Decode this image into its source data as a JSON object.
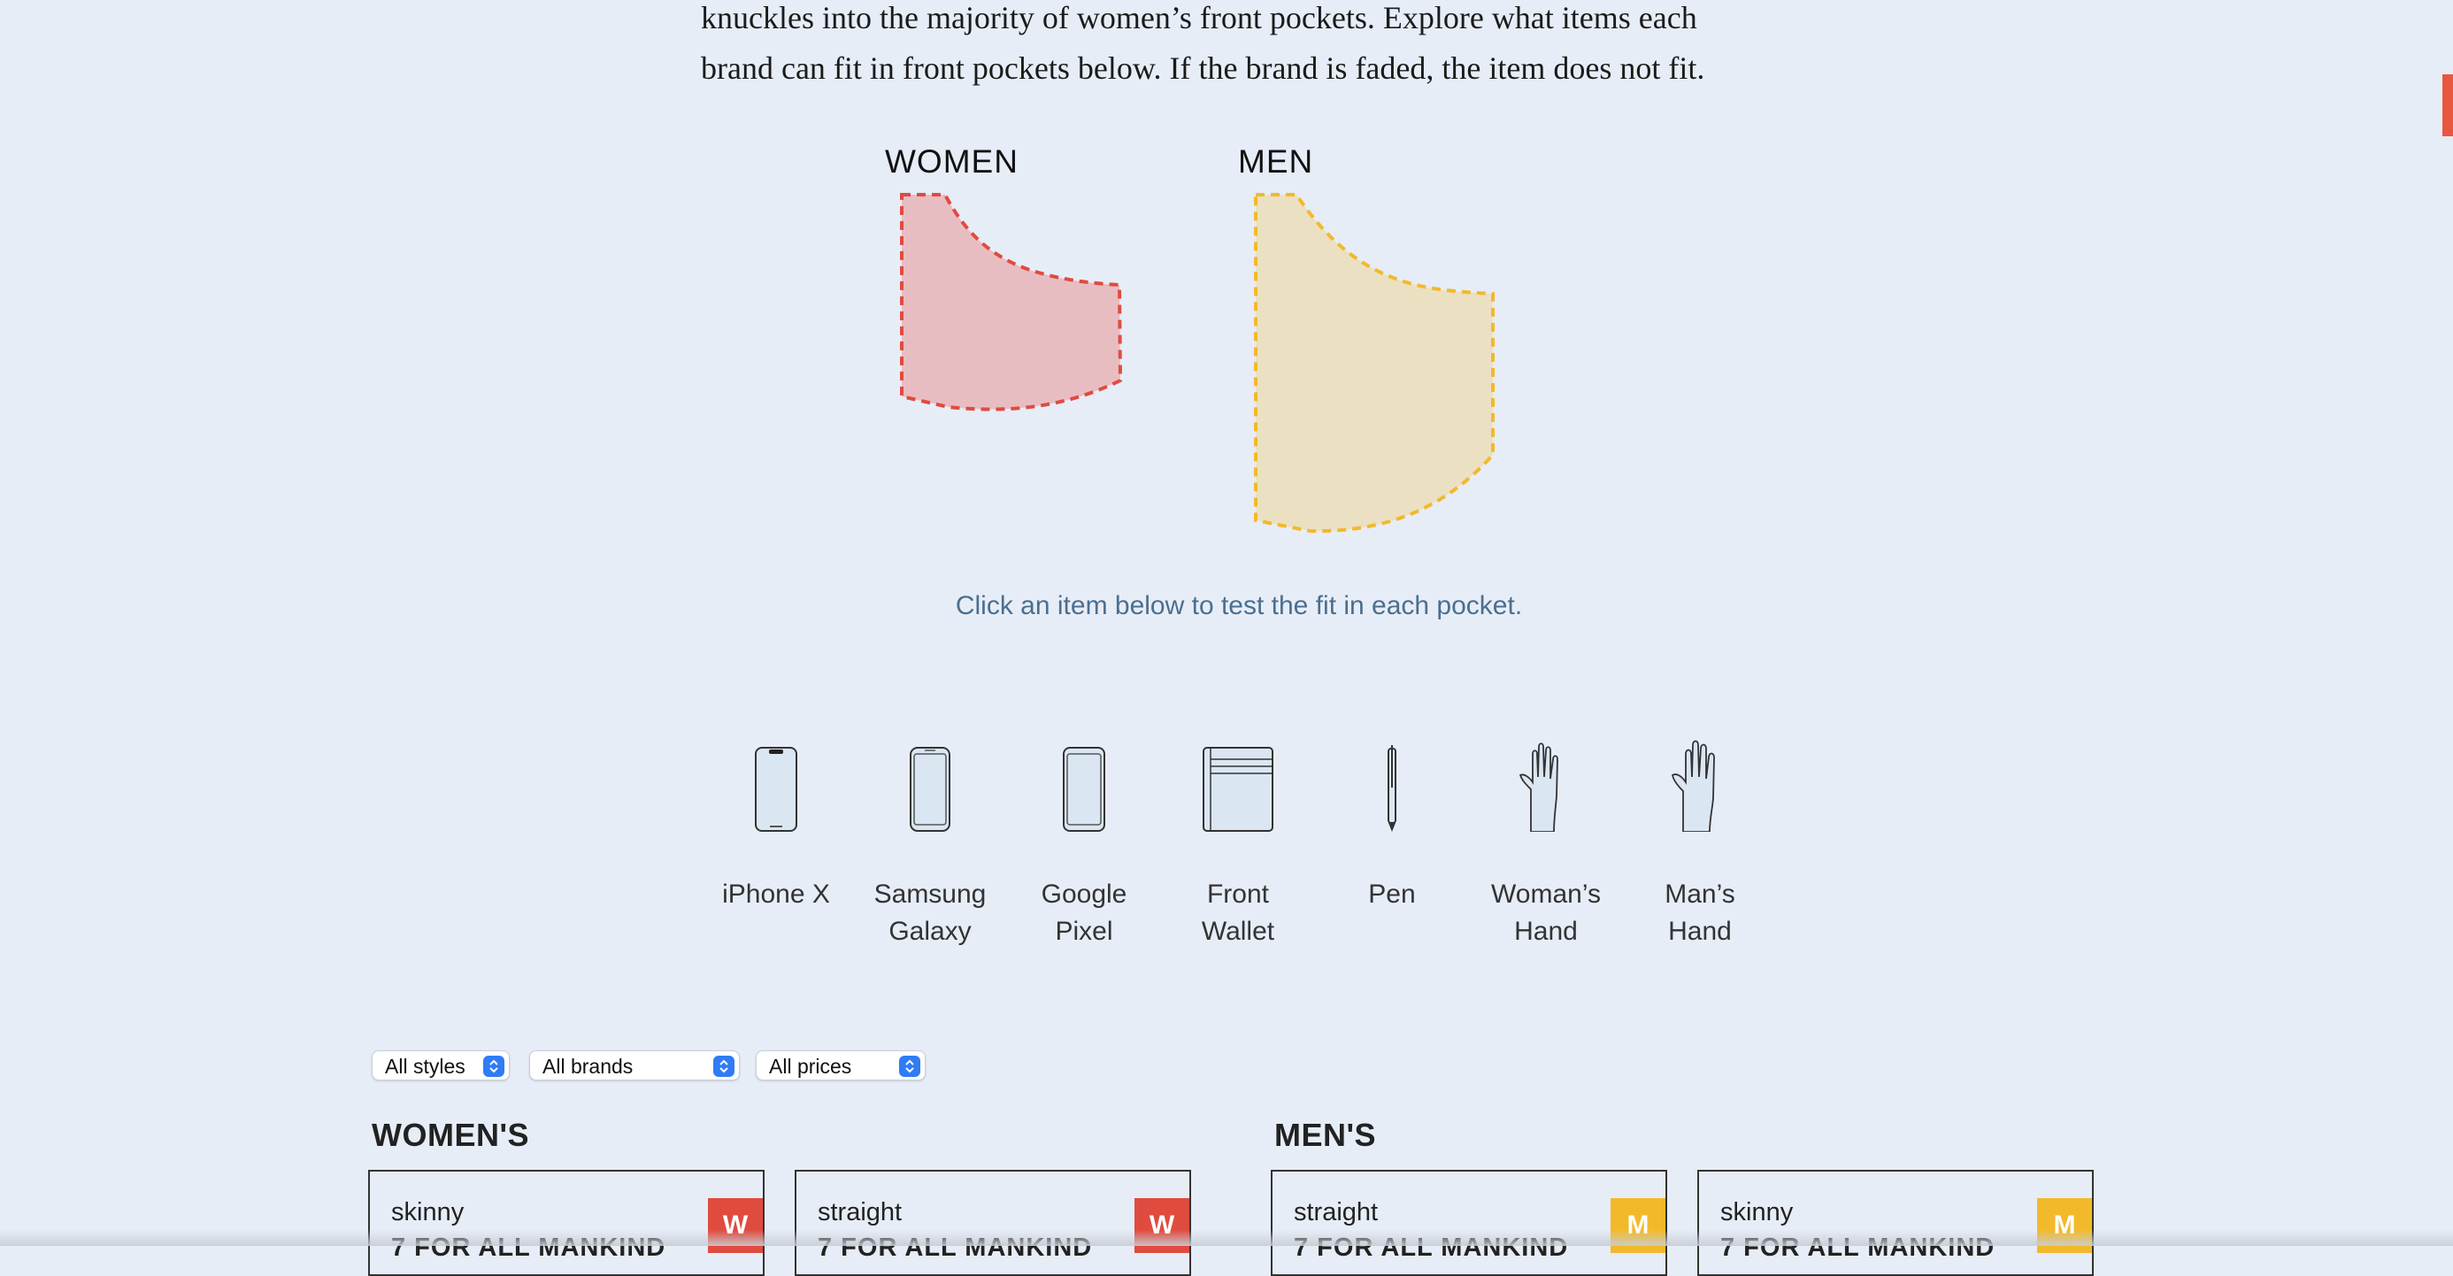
{
  "intro": {
    "line1": "knuckles into the majority of women’s front pockets. Explore what items each",
    "line2": "brand can fit in front pockets below. If the brand is faded, the item does not fit."
  },
  "pockets": {
    "women_label": "WOMEN",
    "men_label": "MEN",
    "women_color": "#e8bdc2",
    "women_stroke": "#e04b3f",
    "men_color": "#ece0c2",
    "men_stroke": "#f2b92a"
  },
  "hint": "Click an item below to test the fit in each pocket.",
  "items": [
    {
      "icon": "iphone-x-icon",
      "line1": "iPhone X",
      "line2": ""
    },
    {
      "icon": "samsung-galaxy-icon",
      "line1": "Samsung",
      "line2": "Galaxy"
    },
    {
      "icon": "google-pixel-icon",
      "line1": "Google",
      "line2": "Pixel"
    },
    {
      "icon": "front-wallet-icon",
      "line1": "Front",
      "line2": "Wallet"
    },
    {
      "icon": "pen-icon",
      "line1": "Pen",
      "line2": ""
    },
    {
      "icon": "womans-hand-icon",
      "line1": "Woman’s",
      "line2": "Hand"
    },
    {
      "icon": "mans-hand-icon",
      "line1": "Man’s",
      "line2": "Hand"
    }
  ],
  "filters": {
    "styles": "All styles",
    "brands": "All brands",
    "prices": "All prices"
  },
  "sections": {
    "womens": "WOMEN'S",
    "mens": "MEN'S"
  },
  "cards": [
    {
      "style": "skinny",
      "brand": "7 FOR ALL MANKIND",
      "badge": "W",
      "badge_color": "#e04b3f"
    },
    {
      "style": "straight",
      "brand": "7 FOR ALL MANKIND",
      "badge": "W",
      "badge_color": "#e04b3f"
    },
    {
      "style": "straight",
      "brand": "7 FOR ALL MANKIND",
      "badge": "M",
      "badge_color": "#f2b92a"
    },
    {
      "style": "skinny",
      "brand": "7 FOR ALL MANKIND",
      "badge": "M",
      "badge_color": "#f2b92a"
    }
  ]
}
